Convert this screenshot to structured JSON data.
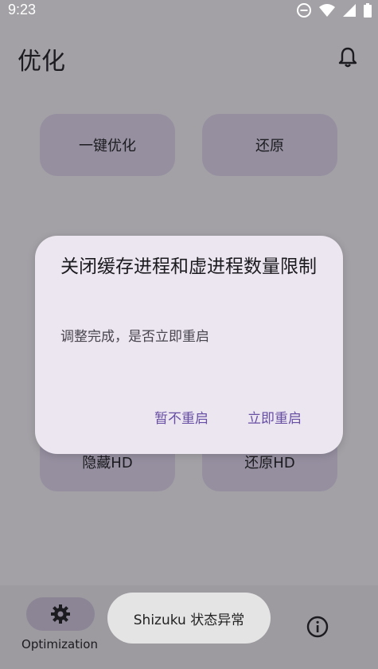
{
  "status_bar": {
    "time": "9:23"
  },
  "app_bar": {
    "title": "优化"
  },
  "buttons": {
    "one_key": "一键优化",
    "restore": "还原",
    "hide_hd": "隐藏HD",
    "restore_hd": "还原HD"
  },
  "dialog": {
    "title": "关闭缓存进程和虚进程数量限制",
    "message": "调整完成，是否立即重启",
    "actions": {
      "later": "暂不重启",
      "now": "立即重启"
    }
  },
  "nav": {
    "label": "Optimization"
  },
  "toast": {
    "text": "Shizuku 状态异常"
  },
  "icons": {
    "dnd": "do-not-disturb-icon",
    "wifi": "wifi-icon",
    "signal": "signal-icon",
    "battery": "battery-icon",
    "bell": "bell-icon",
    "gear": "gear-icon",
    "info": "info-icon"
  },
  "colors": {
    "accent": "#6750a4",
    "scrim": "#a3a1a6",
    "dialog_bg": "#ece6f0"
  }
}
